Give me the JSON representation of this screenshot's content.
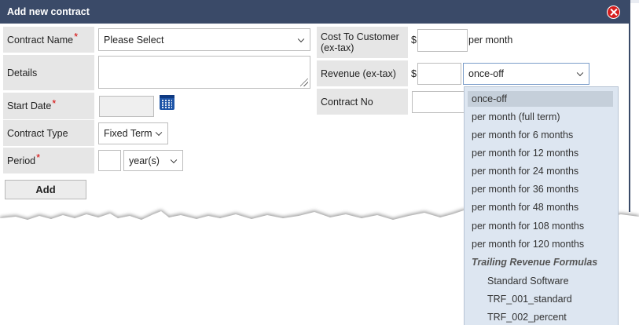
{
  "dialog": {
    "title": "Add new contract"
  },
  "left_form": {
    "contract_name": {
      "label": "Contract Name",
      "value": "Please Select"
    },
    "details": {
      "label": "Details"
    },
    "start_date": {
      "label": "Start Date"
    },
    "contract_type": {
      "label": "Contract Type",
      "value": "Fixed Term"
    },
    "period": {
      "label": "Period",
      "unit": "year(s)"
    },
    "add_button": "Add",
    "required_marker": "*"
  },
  "right_form": {
    "cost_label": "Cost To Customer (ex-tax)",
    "cost_currency": "$",
    "cost_suffix": "per month",
    "revenue_label": "Revenue (ex-tax)",
    "revenue_currency": "$",
    "revenue_frequency": "once-off",
    "contract_no_label": "Contract No"
  },
  "revenue_dropdown": {
    "options": [
      "once-off",
      "per month (full term)",
      "per month for 6 months",
      "per month for 12 months",
      "per month for 24 months",
      "per month for 36 months",
      "per month for 48 months",
      "per month for 108 months",
      "per month for 120 months"
    ],
    "group_label": "Trailing Revenue Formulas",
    "group_options": [
      "Standard Software",
      "TRF_001_standard",
      "TRF_002_percent"
    ]
  },
  "icons": [
    "close-icon",
    "calendar-icon",
    "chevron-down-icon",
    "resize-grip-icon"
  ]
}
